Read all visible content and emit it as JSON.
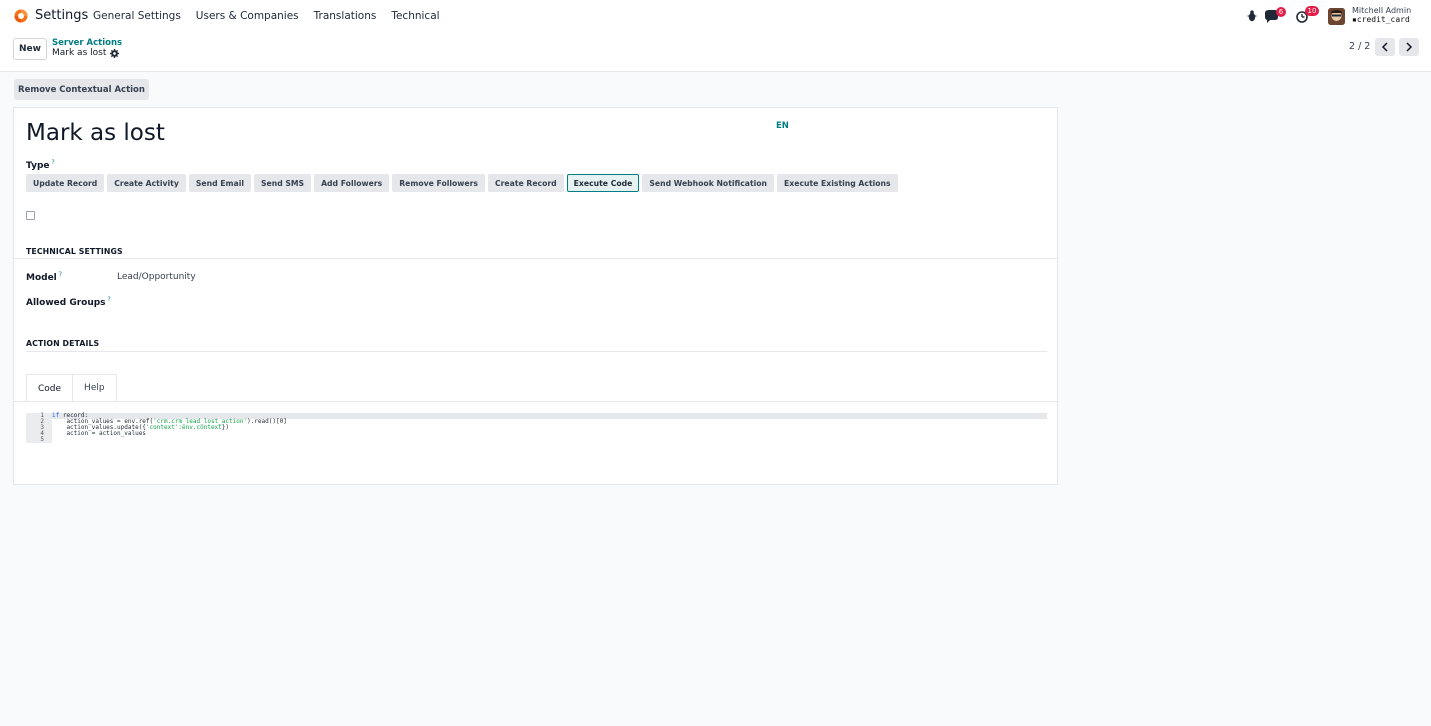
{
  "navbar": {
    "app_name": "Settings",
    "menu": [
      "General Settings",
      "Users & Companies",
      "Translations",
      "Technical"
    ],
    "messages_count": "6",
    "activities_count": "10",
    "user_name": "Mitchell Admin",
    "user_db": "credit_card"
  },
  "control": {
    "new_label": "New",
    "breadcrumb_parent": "Server Actions",
    "breadcrumb_current": "Mark as lost",
    "pager": "2 / 2"
  },
  "actions": {
    "remove_contextual": "Remove Contextual Action"
  },
  "form": {
    "title": "Mark as lost",
    "lang": "EN",
    "type_label": "Type",
    "help_mark": "?",
    "types": [
      "Update Record",
      "Create Activity",
      "Send Email",
      "Send SMS",
      "Add Followers",
      "Remove Followers",
      "Create Record",
      "Execute Code",
      "Send Webhook Notification",
      "Execute Existing Actions"
    ],
    "active_type": "Execute Code",
    "technical_settings": "TECHNICAL SETTINGS",
    "model_label": "Model",
    "model_value": "Lead/Opportunity",
    "groups_label": "Allowed Groups",
    "action_details": "ACTION DETAILS",
    "tabs": [
      "Code",
      "Help"
    ],
    "code": {
      "line_numbers": [
        "1",
        "2",
        "3",
        "4",
        "5"
      ],
      "l1_kw": "if",
      "l1_rest": " record:",
      "l2_a": "    action_values = env.ref(",
      "l2_str": "'crm.crm_lead_lost_action'",
      "l2_b": ").read()[0]",
      "l3_a": "    action_values.update({",
      "l3_str": "'context':env.context",
      "l3_b": "})",
      "l4": "    action = action_values",
      "l5": ""
    }
  },
  "colors": {
    "accent": "#017e84",
    "badge": "#e11d48"
  }
}
